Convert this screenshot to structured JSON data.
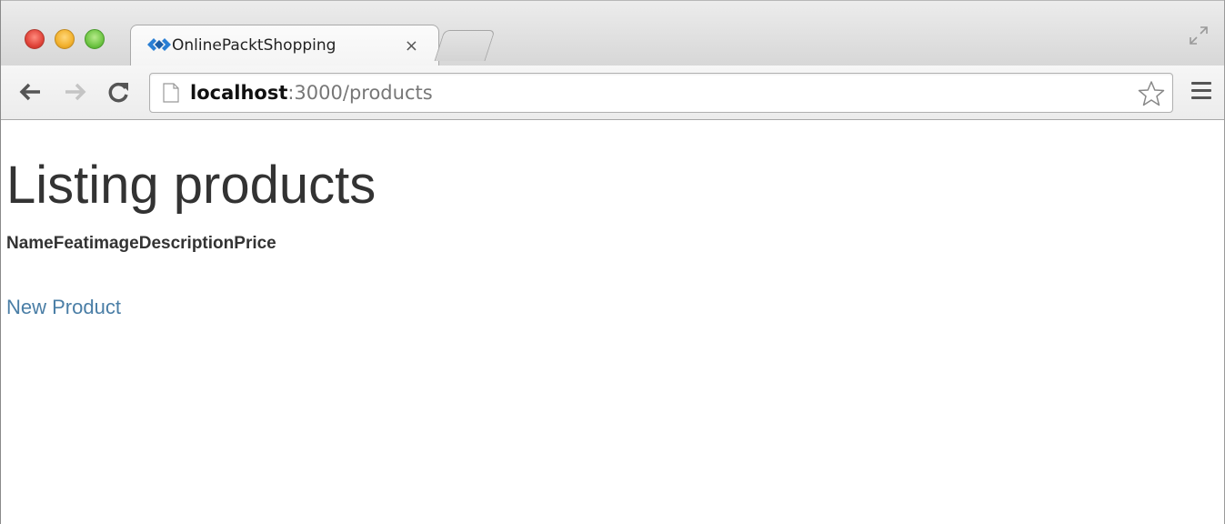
{
  "browser": {
    "tab": {
      "title": "OnlinePacktShopping",
      "close_label": "×"
    },
    "address_bar": {
      "host": "localhost",
      "path": ":3000/products"
    },
    "icons": {
      "close": "close-window-icon",
      "minimize": "minimize-window-icon",
      "maximize": "maximize-window-icon",
      "favicon": "diamond-arrows-favicon",
      "fullscreen": "fullscreen-icon",
      "back": "back-arrow-icon",
      "forward": "forward-arrow-icon",
      "reload": "reload-icon",
      "page": "page-icon",
      "bookmark": "star-icon",
      "menu": "hamburger-menu-icon"
    },
    "colors": {
      "link": "#4a7ea6",
      "favicon": "#2a7fd4"
    }
  },
  "page": {
    "title": "Listing products",
    "table_headers": [
      "Name",
      "Featimage",
      "Description",
      "Price"
    ],
    "new_product_link": "New Product"
  }
}
